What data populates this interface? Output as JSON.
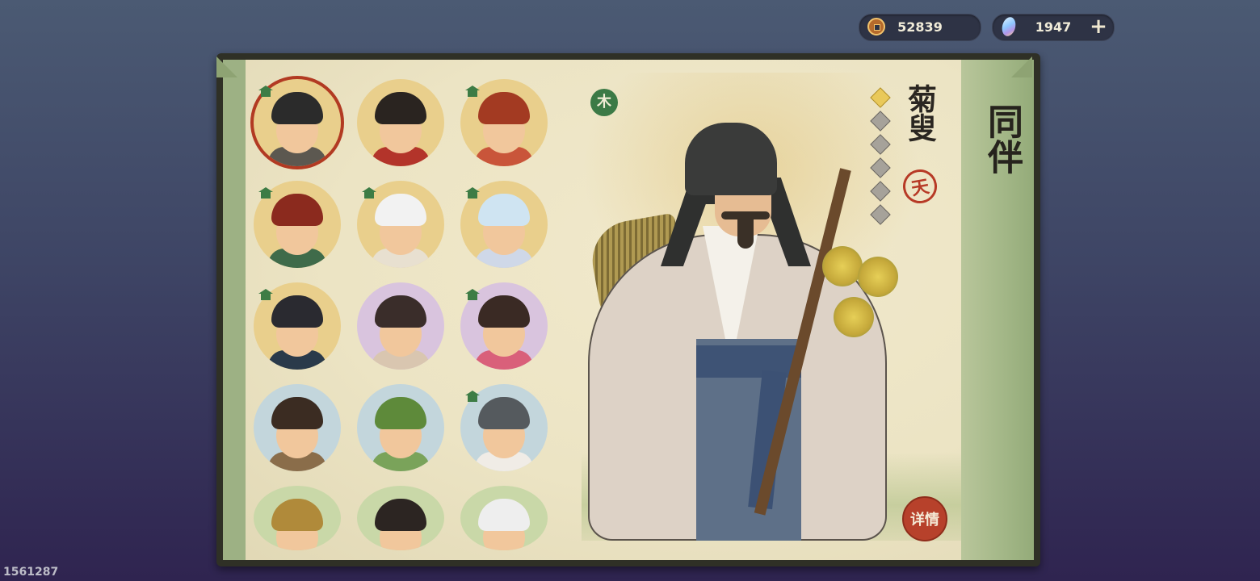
{
  "currency": {
    "coins": "52839",
    "gems": "1947",
    "coin_icon": "copper-coin-icon",
    "gem_icon": "spirit-gem-icon",
    "add_icon": "plus-icon"
  },
  "panel": {
    "title": "同伴",
    "element_badge": "木",
    "details_label": "详情"
  },
  "character": {
    "name": "菊叟",
    "tier_seal": "天",
    "stars_total": 6,
    "stars_lit": 1
  },
  "roster": [
    {
      "id": 1,
      "frame": "gold",
      "housed": true,
      "selected": true
    },
    {
      "id": 2,
      "frame": "gold",
      "housed": false,
      "selected": false
    },
    {
      "id": 3,
      "frame": "gold",
      "housed": true,
      "selected": false
    },
    {
      "id": 4,
      "frame": "gold",
      "housed": true,
      "selected": false
    },
    {
      "id": 5,
      "frame": "gold",
      "housed": true,
      "selected": false
    },
    {
      "id": 6,
      "frame": "gold",
      "housed": true,
      "selected": false
    },
    {
      "id": 7,
      "frame": "gold",
      "housed": true,
      "selected": false
    },
    {
      "id": 8,
      "frame": "purple",
      "housed": false,
      "selected": false
    },
    {
      "id": 9,
      "frame": "purple",
      "housed": true,
      "selected": false
    },
    {
      "id": 10,
      "frame": "blue",
      "housed": false,
      "selected": false
    },
    {
      "id": 11,
      "frame": "blue",
      "housed": false,
      "selected": false
    },
    {
      "id": 12,
      "frame": "blue",
      "housed": true,
      "selected": false
    },
    {
      "id": 13,
      "frame": "green",
      "housed": false,
      "selected": false
    },
    {
      "id": 14,
      "frame": "green",
      "housed": false,
      "selected": false
    },
    {
      "id": 15,
      "frame": "green",
      "housed": false,
      "selected": false
    }
  ],
  "footer": {
    "player_id": "1561287"
  },
  "colors": {
    "accent_red": "#b7412b",
    "wood_green": "#3c7a46",
    "paper": "#ece4c4"
  }
}
